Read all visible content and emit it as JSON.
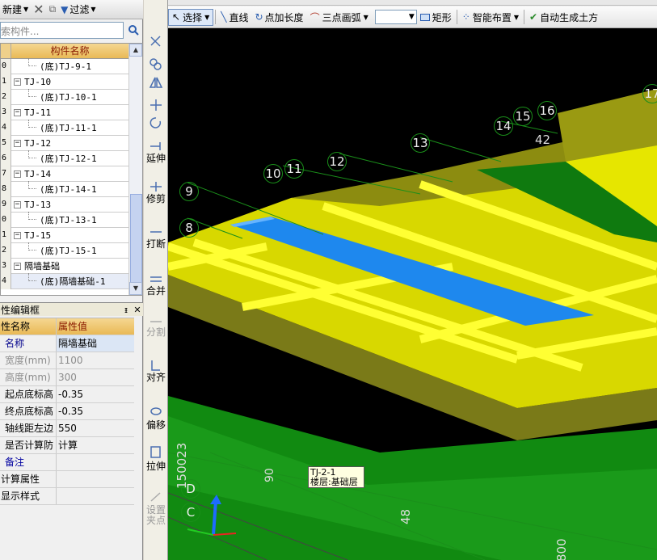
{
  "left_toolbar": {
    "new_label": "新建",
    "filter_label": "过滤"
  },
  "search": {
    "placeholder": "索构件..."
  },
  "component_list": {
    "header": "构件名称",
    "rows": [
      {
        "num": "0",
        "indent": 1,
        "label": "(底)TJ-9-1"
      },
      {
        "num": "1",
        "indent": 0,
        "label": "TJ-10"
      },
      {
        "num": "2",
        "indent": 1,
        "label": "(底)TJ-10-1"
      },
      {
        "num": "3",
        "indent": 0,
        "label": "TJ-11"
      },
      {
        "num": "4",
        "indent": 1,
        "label": "(底)TJ-11-1"
      },
      {
        "num": "5",
        "indent": 0,
        "label": "TJ-12"
      },
      {
        "num": "6",
        "indent": 1,
        "label": "(底)TJ-12-1"
      },
      {
        "num": "7",
        "indent": 0,
        "label": "TJ-14"
      },
      {
        "num": "8",
        "indent": 1,
        "label": "(底)TJ-14-1"
      },
      {
        "num": "9",
        "indent": 0,
        "label": "TJ-13"
      },
      {
        "num": "0",
        "indent": 1,
        "label": "(底)TJ-13-1"
      },
      {
        "num": "1",
        "indent": 0,
        "label": "TJ-15"
      },
      {
        "num": "2",
        "indent": 1,
        "label": "(底)TJ-15-1"
      },
      {
        "num": "3",
        "indent": 0,
        "label": "隔墙基础"
      },
      {
        "num": "4",
        "indent": 1,
        "label": "(底)隔墙基础-1"
      }
    ]
  },
  "property_panel": {
    "title": "性编辑框",
    "col_name": "性名称",
    "col_value": "属性值",
    "rows": [
      {
        "k": "名称",
        "v": "隔墙基础",
        "style": "name"
      },
      {
        "k": "宽度(mm)",
        "v": "1100",
        "style": "gray"
      },
      {
        "k": "高度(mm)",
        "v": "300",
        "style": "gray"
      },
      {
        "k": "起点底标高",
        "v": "-0.35",
        "style": ""
      },
      {
        "k": "终点底标高",
        "v": "-0.35",
        "style": ""
      },
      {
        "k": "轴线距左边",
        "v": "550",
        "style": ""
      },
      {
        "k": "是否计算防",
        "v": "计算",
        "style": ""
      },
      {
        "k": "备注",
        "v": "",
        "style": "blue"
      },
      {
        "k": "计算属性",
        "v": "",
        "style": "group"
      },
      {
        "k": "显示样式",
        "v": "",
        "style": "group"
      }
    ]
  },
  "side_tools": {
    "extend": "延伸",
    "trim": "修剪",
    "break": "打断",
    "merge": "合并",
    "split": "分割",
    "align": "对齐",
    "offset": "偏移",
    "stretch": "拉伸",
    "set_grip": "设置夹点"
  },
  "draw_toolbar": {
    "select": "选择",
    "line": "直线",
    "point_length": "点加长度",
    "arc": "三点画弧",
    "rect": "矩形",
    "smart_layout": "智能布置",
    "auto_earthwork": "自动生成土方"
  },
  "viewport": {
    "axis_labels": [
      "17",
      "16",
      "15",
      "14",
      "13",
      "12",
      "11",
      "10",
      "9",
      "8",
      "D",
      "C"
    ],
    "dim_texts": [
      "42",
      "150023",
      "90",
      "48",
      "800"
    ],
    "tooltip_line1": "TJ-2-1",
    "tooltip_line2": "楼层:基础层"
  },
  "colors": {
    "yellow": "#e6e600",
    "blue": "#1e88ee",
    "green": "#1a8f1a",
    "accent_header": "#e9b956"
  }
}
